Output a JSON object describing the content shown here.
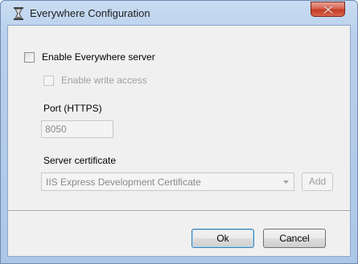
{
  "window": {
    "title": "Everywhere Configuration",
    "icon": "hourglass-icon"
  },
  "form": {
    "enable_server": {
      "label": "Enable Everywhere server",
      "checked": false
    },
    "enable_write": {
      "label": "Enable write access",
      "checked": false,
      "enabled": false
    },
    "port": {
      "label": "Port (HTTPS)",
      "value": "8050"
    },
    "certificate": {
      "label": "Server certificate",
      "selected": "IIS Express Development Certificate",
      "add_label": "Add"
    }
  },
  "buttons": {
    "ok_label": "Ok",
    "cancel_label": "Cancel"
  },
  "colors": {
    "titlebar": "#b9d0ec",
    "client": "#f0f0f0",
    "close": "#c43b23",
    "disabled_text": "#a0a0a0"
  }
}
